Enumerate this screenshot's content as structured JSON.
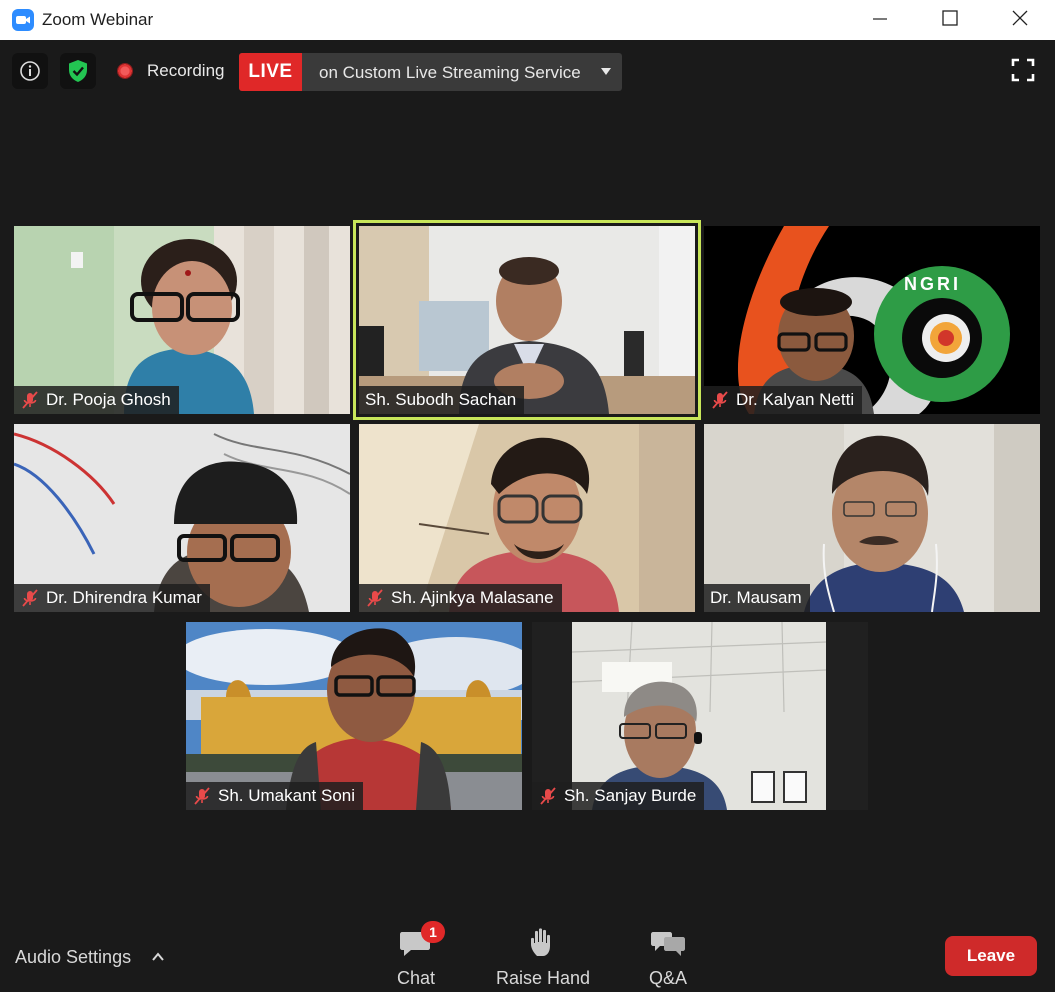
{
  "window": {
    "title": "Zoom Webinar",
    "controls": [
      "minimize",
      "maximize",
      "close"
    ]
  },
  "topbar": {
    "info_icon": "info-icon",
    "security_icon": "shield-check-icon",
    "recording_label": "Recording",
    "live_badge": "LIVE",
    "live_stream_label": "on Custom Live Streaming Service",
    "fullscreen_icon": "fullscreen-icon"
  },
  "participants": [
    {
      "name": "Dr. Pooja Ghosh",
      "muted": true,
      "active": false
    },
    {
      "name": "Sh. Subodh Sachan",
      "muted": false,
      "active": true
    },
    {
      "name": "Dr. Kalyan Netti",
      "muted": true,
      "active": false,
      "background_logo_text": "NGRI"
    },
    {
      "name": "Dr. Dhirendra Kumar",
      "muted": true,
      "active": false
    },
    {
      "name": "Sh. Ajinkya Malasane",
      "muted": true,
      "active": false
    },
    {
      "name": "Dr. Mausam",
      "muted": false,
      "active": false
    },
    {
      "name": "Sh. Umakant Soni",
      "muted": true,
      "active": false
    },
    {
      "name": "Sh. Sanjay Burde",
      "muted": true,
      "active": false
    }
  ],
  "bottombar": {
    "audio_settings_label": "Audio Settings",
    "chat_label": "Chat",
    "chat_badge": "1",
    "raise_hand_label": "Raise Hand",
    "qa_label": "Q&A",
    "leave_label": "Leave"
  },
  "colors": {
    "background": "#1a1a1a",
    "live_red": "#e02828",
    "active_speaker_border": "#c8e65a",
    "leave_red": "#cf2a2a",
    "zoom_blue": "#2d8cff"
  }
}
